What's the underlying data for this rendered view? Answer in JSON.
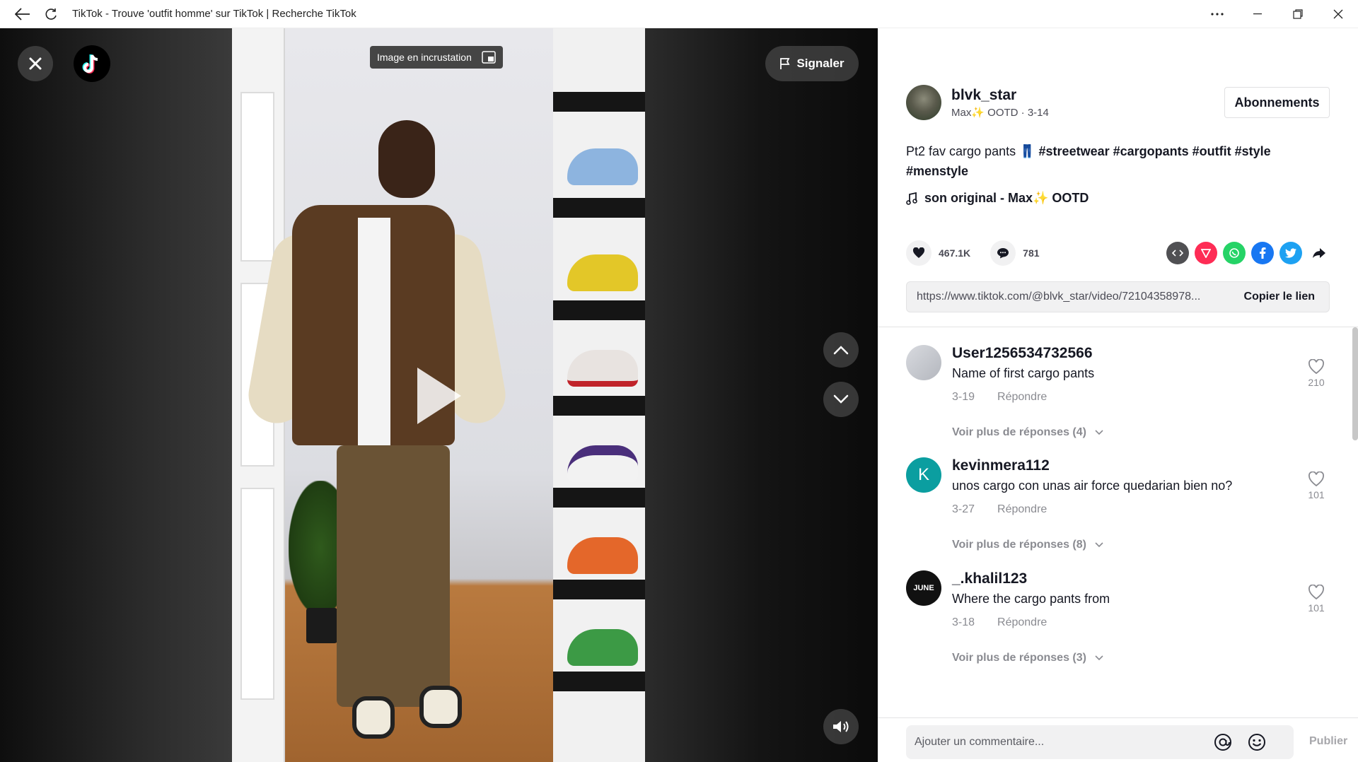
{
  "window": {
    "title": "TikTok - Trouve 'outfit homme' sur TikTok | Recherche TikTok"
  },
  "video": {
    "pip_label": "Image en incrustation",
    "report_label": "Signaler"
  },
  "author": {
    "username": "blvk_star",
    "display": "Max✨ OOTD · 3-14",
    "follow_label": "Abonnements"
  },
  "description": {
    "text": "Pt2 fav cargo pants ",
    "emoji": "👖",
    "hashtags": "#streetwear #cargopants #outfit #style #menstyle"
  },
  "music": {
    "label": "son original - Max✨ OOTD"
  },
  "stats": {
    "likes": "467.1K",
    "comments": "781"
  },
  "share": {
    "icons": [
      "embed-icon",
      "tiktok-send-icon",
      "whatsapp-icon",
      "facebook-icon",
      "twitter-icon",
      "share-arrow-icon"
    ]
  },
  "link": {
    "url": "https://www.tiktok.com/@blvk_star/video/72104358978...",
    "copy_label": "Copier le lien"
  },
  "comments": [
    {
      "user": "User1256534732566",
      "text": "Name of first cargo pants",
      "date": "3-19",
      "reply": "Répondre",
      "more": "Voir plus de réponses (4)",
      "likes": "210",
      "avatar_color": "#c9cbd0",
      "avatar_letter": ""
    },
    {
      "user": "kevinmera112",
      "text": "unos cargo con unas air force quedarian bien no?",
      "date": "3-27",
      "reply": "Répondre",
      "more": "Voir plus de réponses (8)",
      "likes": "101",
      "avatar_color": "#0b9ea0",
      "avatar_letter": "K"
    },
    {
      "user": "_.khalil123",
      "text": "Where the cargo pants from",
      "date": "3-18",
      "reply": "Répondre",
      "more": "Voir plus de réponses (3)",
      "likes": "101",
      "avatar_color": "#111111",
      "avatar_letter": "JUNE"
    }
  ],
  "composer": {
    "placeholder": "Ajouter un commentaire...",
    "publish_label": "Publier"
  }
}
